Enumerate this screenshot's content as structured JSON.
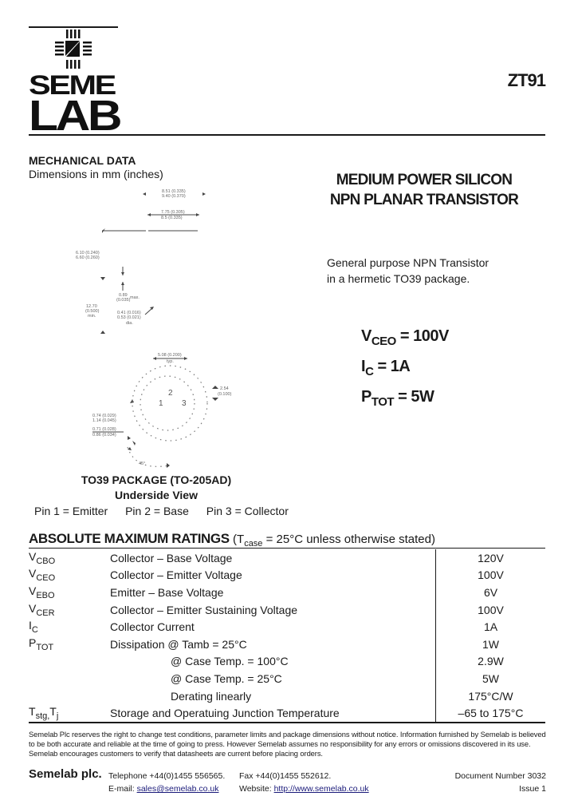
{
  "header": {
    "brand_line1": "SEME",
    "brand_line2": "LAB",
    "part_number": "ZT91"
  },
  "mechanical": {
    "title": "MECHANICAL DATA",
    "subtitle": "Dimensions in mm (inches)",
    "dims": {
      "d1": "8.51 (0.335)",
      "d1b": "9.40 (0.370)",
      "d2": "7.75 (0.305)",
      "d2b": "8.5 (0.335)",
      "d3": "6.10 (0.240)",
      "d3b": "6.60 (0.260)",
      "d4": "0.89",
      "d4b": "(0.035)",
      "d4c": "max.",
      "d5": "12.70",
      "d5b": "(0.500)",
      "d5c": "min.",
      "d6": "0.41 (0.016)",
      "d6b": "0.53 (0.021)",
      "d6c": "dia.",
      "d7": "5.08 (0.200)",
      "d7b": "typ.",
      "d8": "2.54",
      "d8b": "(0.100)",
      "d9": "0.74 (0.029)",
      "d9b": "1.14 (0.045)",
      "d10": "0.71 (0.028)",
      "d10b": "0.86 (0.034)",
      "angle": "45°",
      "pin1": "1",
      "pin2": "2",
      "pin3": "3"
    },
    "package_title": "TO39 PACKAGE (TO-205AD)",
    "view": "Underside View",
    "pins": [
      "Pin 1 = Emitter",
      "Pin 2 = Base",
      "Pin 3 = Collector"
    ]
  },
  "product": {
    "title_line1": "MEDIUM POWER SILICON",
    "title_line2": "NPN PLANAR TRANSISTOR",
    "desc_line1": "General purpose NPN Transistor",
    "desc_line2": "in a hermetic TO39 package.",
    "specs": [
      {
        "sym": "V",
        "sub": "CEO",
        "val": " = 100V"
      },
      {
        "sym": "I",
        "sub": "C",
        "val": " = 1A"
      },
      {
        "sym": "P",
        "sub": "TOT",
        "val": " = 5W"
      }
    ]
  },
  "ratings": {
    "title": "ABSOLUTE MAXIMUM RATINGS",
    "cond_pre": "(T",
    "cond_sub": "case",
    "cond_post": " = 25°C unless otherwise stated)",
    "rows": [
      {
        "sym": "V",
        "sub": "CBO",
        "desc": "Collector – Base Voltage",
        "val": "120V"
      },
      {
        "sym": "V",
        "sub": "CEO",
        "desc": "Collector – Emitter Voltage",
        "val": "100V"
      },
      {
        "sym": "V",
        "sub": "EBO",
        "desc": "Emitter – Base Voltage",
        "val": "6V"
      },
      {
        "sym": "V",
        "sub": "CER",
        "desc": "Collector – Emitter Sustaining Voltage",
        "val": "100V"
      },
      {
        "sym": "I",
        "sub": "C",
        "desc": "Collector Current",
        "val": "1A"
      },
      {
        "sym": "P",
        "sub": "TOT",
        "desc": "Dissipation @ Tamb = 25°C",
        "val": "1W"
      },
      {
        "sym": "",
        "sub": "",
        "desc": "@ Case Temp. = 100°C",
        "val": "2.9W"
      },
      {
        "sym": "",
        "sub": "",
        "desc": "@ Case Temp. = 25°C",
        "val": "5W"
      },
      {
        "sym": "",
        "sub": "",
        "desc": "Derating linearly",
        "val": "175°C/W"
      },
      {
        "sym": "T",
        "sub": "stg,",
        "sym2": "T",
        "sub2": "j",
        "desc": "Storage and Operatuing Junction Temperature",
        "val": "–65 to 175°C"
      }
    ]
  },
  "footer": {
    "disclaimer": "Semelab Plc reserves the right to change test conditions, parameter limits and package dimensions without notice. Information furnished by Semelab is believed to be both accurate and reliable at the time of going to press. However Semelab assumes no responsibility for any errors or omissions discovered in its use. Semelab encourages customers to verify that datasheets are current before placing orders.",
    "company": "Semelab plc.",
    "telephone": "Telephone +44(0)1455 556565.",
    "fax": "Fax +44(0)1455 552612.",
    "email_label": "E-mail: ",
    "email": "sales@semelab.co.uk",
    "website_label": "Website: ",
    "website": "http://www.semelab.co.uk",
    "doc_number": "Document Number 3032",
    "issue": "Issue 1"
  }
}
